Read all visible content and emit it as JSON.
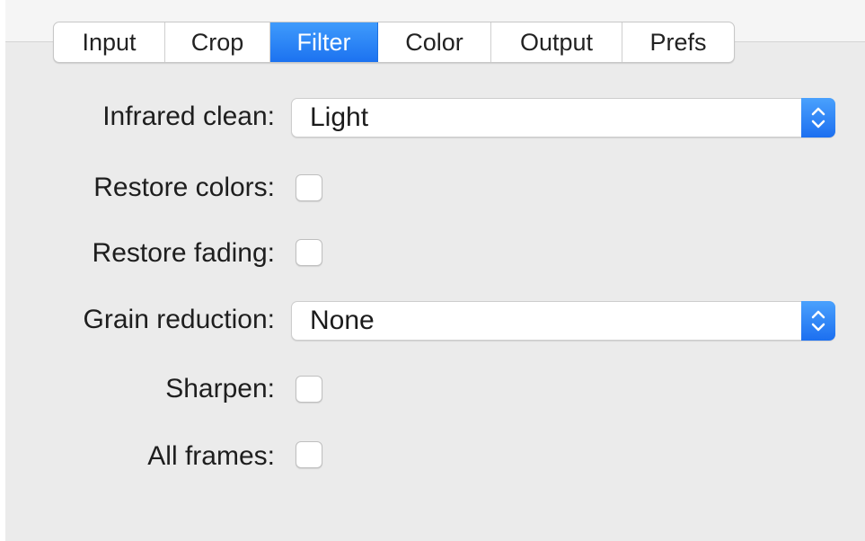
{
  "tabs": [
    {
      "label": "Input"
    },
    {
      "label": "Crop"
    },
    {
      "label": "Filter"
    },
    {
      "label": "Color"
    },
    {
      "label": "Output"
    },
    {
      "label": "Prefs"
    }
  ],
  "active_tab": "Filter",
  "form": {
    "infrared_clean": {
      "label": "Infrared clean:",
      "value": "Light"
    },
    "restore_colors": {
      "label": "Restore colors:",
      "checked": false
    },
    "restore_fading": {
      "label": "Restore fading:",
      "checked": false
    },
    "grain_reduction": {
      "label": "Grain reduction:",
      "value": "None"
    },
    "sharpen": {
      "label": "Sharpen:",
      "checked": false
    },
    "all_frames": {
      "label": "All frames:",
      "checked": false
    }
  },
  "icons": {
    "stepper": "up-down-chevron-icon"
  },
  "colors": {
    "accent": "#1c72f0",
    "panel": "#ebebeb"
  }
}
